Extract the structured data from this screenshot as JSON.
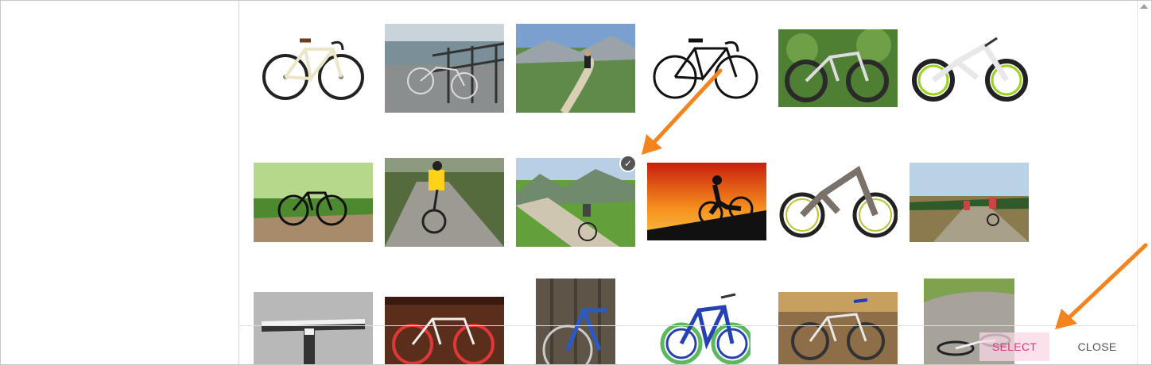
{
  "footer": {
    "select_label": "SELECT",
    "close_label": "CLOSE"
  },
  "gallery": {
    "selected_index": 8,
    "items": [
      "road-bike-white",
      "bike-by-railing",
      "mountain-trail-rider",
      "black-road-bike-silhouette",
      "full-suspension-mtb-grass",
      "white-downhill-mtb",
      "bike-in-forest",
      "rider-gravel-path",
      "rider-alpine-valley",
      "sunset-silhouette-rider",
      "grey-downhill-mtb",
      "riders-heath-trail",
      "snowy-handlebar",
      "red-rim-fixie",
      "blue-bike-at-door",
      "blue-green-mtb",
      "bike-on-gravel-leaves",
      "fallen-bike-on-path"
    ]
  },
  "colors": {
    "accent": "#d8377b",
    "arrow": "#f5841f"
  }
}
